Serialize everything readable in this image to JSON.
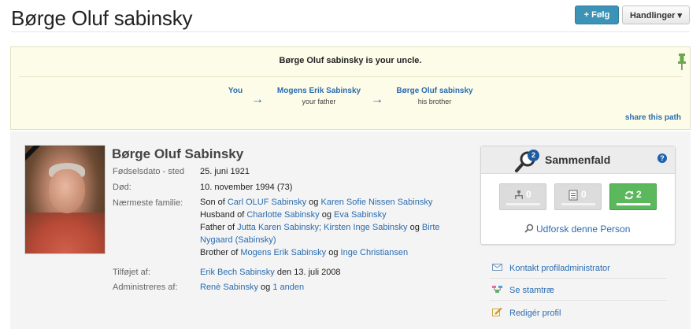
{
  "header": {
    "title": "Børge Oluf sabinsky",
    "follow_label": "+ Følg",
    "actions_label": "Handlinger ▾"
  },
  "relationship": {
    "headline": "Børge Oluf sabinsky is your uncle.",
    "chain": [
      {
        "name": "You",
        "sub": ""
      },
      {
        "name": "Mogens Erik Sabinsky",
        "sub": "your father"
      },
      {
        "name": "Børge Oluf sabinsky",
        "sub": "his brother"
      }
    ],
    "arrow": "→",
    "share_label": "share this path"
  },
  "profile": {
    "name": "Børge Oluf Sabinsky",
    "birth_label": "Fødselsdato - sted",
    "birth_value": "25. juni 1921",
    "death_label": "Død:",
    "death_value": "10. november 1994 (73)",
    "family_label": "Nærmeste familie:",
    "family": {
      "son_of_prefix": "Son of ",
      "father_name": "Carl OLUF Sabinsky",
      "and1": " og ",
      "mother_name": "Karen Sofie Nissen Sabinsky",
      "husband_prefix": "Husband of ",
      "wife1": "Charlotte Sabinsky",
      "and2": " og ",
      "wife2": "Eva Sabinsky",
      "father_prefix": "Father of ",
      "child1": "Jutta Karen Sabinsky;",
      "child2": " Kirsten Inge Sabinsky",
      "and3": " og ",
      "child3": "Birte Nygaard (Sabinsky)",
      "brother_prefix": "Brother of ",
      "sib1": "Mogens Erik Sabinsky",
      "and4": " og ",
      "sib2": "Inge Christiansen"
    },
    "added_label": "Tilføjet af:",
    "added_by": "Erik Bech Sabinsky",
    "added_date": " den 13. juli 2008",
    "managed_label": "Administreres af:",
    "manager1": "Renè Sabinsky",
    "and5": " og ",
    "manager2": "1 anden"
  },
  "matches": {
    "title": "Sammenfald",
    "badge": "2",
    "help": "?",
    "buttons": [
      {
        "icon": "tree-icon",
        "count": "0"
      },
      {
        "icon": "document-icon",
        "count": "0"
      },
      {
        "icon": "sync-icon",
        "count": "2"
      }
    ],
    "explore_label": "Udforsk denne Person"
  },
  "actions": [
    {
      "icon": "envelope-icon",
      "label": "Kontakt profiladministrator"
    },
    {
      "icon": "family-tree-icon",
      "label": "Se stamtræ"
    },
    {
      "icon": "edit-icon",
      "label": "Redigér profil"
    }
  ],
  "colors": {
    "link": "#2a6cb0",
    "follow_button": "#3d93b6",
    "notice_bg": "#fdfce8",
    "match_green": "#5cb85c"
  }
}
